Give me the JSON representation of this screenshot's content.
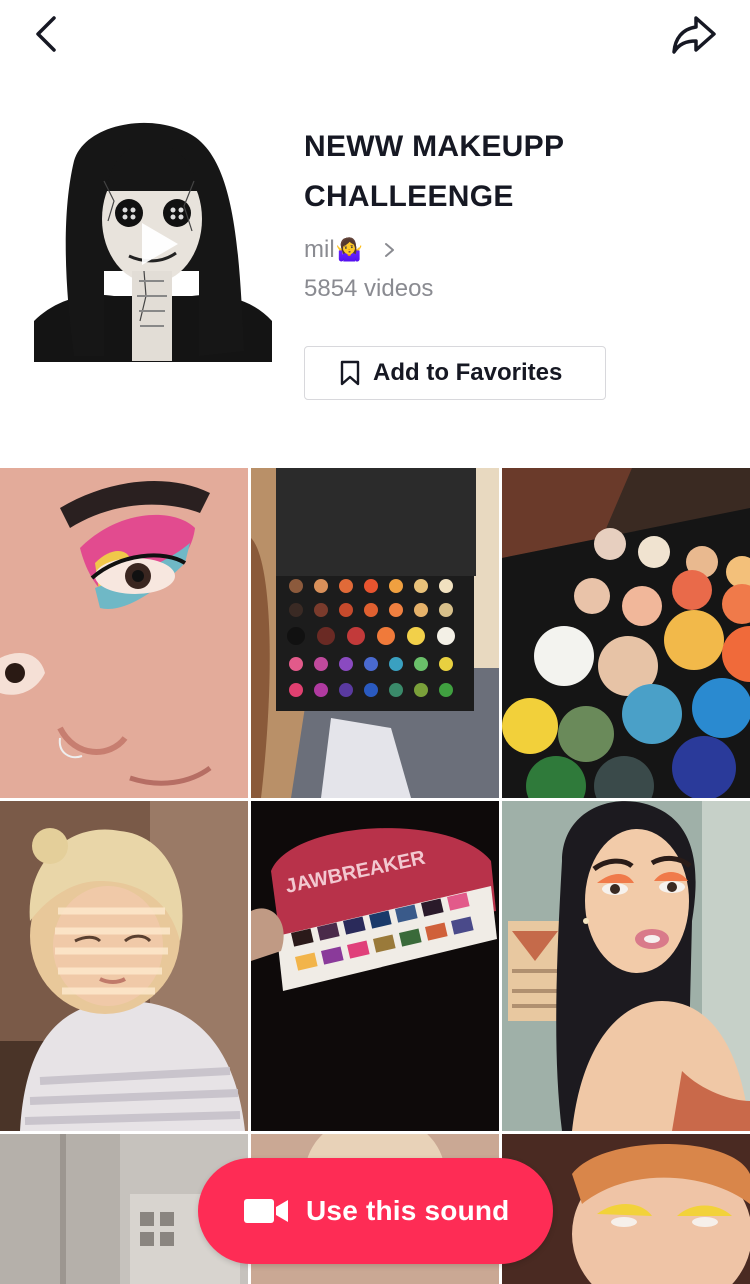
{
  "header": {
    "back_icon": "chevron-left-icon",
    "share_icon": "share-arrow-icon"
  },
  "sound": {
    "title": "NEWW MAKEUPP CHALLEENGE",
    "author": "mil",
    "author_emoji": "🤷‍♀️",
    "video_count": "5854 videos",
    "favorite_label": "Add to Favorites",
    "favorite_icon": "bookmark-icon"
  },
  "videos": [
    {
      "label": "video-1"
    },
    {
      "label": "video-2"
    },
    {
      "label": "video-3"
    },
    {
      "label": "video-4"
    },
    {
      "label": "video-5"
    },
    {
      "label": "video-6"
    },
    {
      "label": "video-7"
    },
    {
      "label": "video-8"
    },
    {
      "label": "video-9"
    }
  ],
  "video_texts": {
    "palette_brand": "JAWBREAKER"
  },
  "cta": {
    "label": "Use this sound",
    "icon": "video-camera-icon",
    "color": "#fe2c55"
  }
}
